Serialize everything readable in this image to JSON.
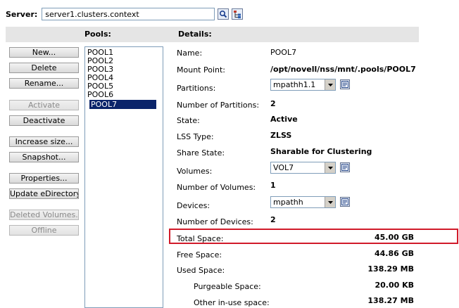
{
  "server": {
    "label": "Server:",
    "value": "server1.clusters.context"
  },
  "headers": {
    "pools": "Pools:",
    "details": "Details:"
  },
  "actions": [
    {
      "label": "New...",
      "enabled": true
    },
    {
      "label": "Delete",
      "enabled": true
    },
    {
      "label": "Rename...",
      "enabled": true
    },
    {
      "label": "Activate",
      "enabled": false
    },
    {
      "label": "Deactivate",
      "enabled": true
    },
    {
      "label": "Increase size...",
      "enabled": true
    },
    {
      "label": "Snapshot...",
      "enabled": true
    },
    {
      "label": "Properties...",
      "enabled": true
    },
    {
      "label": "Update eDirectory",
      "enabled": true
    },
    {
      "label": "Deleted Volumes...",
      "enabled": false
    },
    {
      "label": "Offline",
      "enabled": false
    }
  ],
  "pools": [
    "POOL1",
    "POOL2",
    "POOL3",
    "POOL4",
    "POOL5",
    "POOL6",
    "POOL7"
  ],
  "selected_pool": "POOL7",
  "details": {
    "name": {
      "label": "Name:",
      "value": "POOL7"
    },
    "mount_point": {
      "label": "Mount Point:",
      "value": "/opt/novell/nss/mnt/.pools/POOL7"
    },
    "partitions": {
      "label": "Partitions:",
      "value": "mpathh1.1"
    },
    "num_partitions": {
      "label": "Number of Partitions:",
      "value": "2"
    },
    "state": {
      "label": "State:",
      "value": "Active"
    },
    "lss_type": {
      "label": "LSS Type:",
      "value": "ZLSS"
    },
    "share_state": {
      "label": "Share State:",
      "value": "Sharable for Clustering"
    },
    "volumes": {
      "label": "Volumes:",
      "value": "VOL7"
    },
    "num_volumes": {
      "label": "Number of Volumes:",
      "value": "1"
    },
    "devices": {
      "label": "Devices:",
      "value": "mpathh"
    },
    "num_devices": {
      "label": "Number of Devices:",
      "value": "2"
    },
    "total_space": {
      "label": "Total Space:",
      "value": "45.00 GB"
    },
    "free_space": {
      "label": "Free Space:",
      "value": "44.86 GB"
    },
    "used_space": {
      "label": "Used Space:",
      "value": "138.29 MB"
    },
    "purgeable_space": {
      "label": "Purgeable Space:",
      "value": "20.00 KB"
    },
    "other_inuse_space": {
      "label": "Other in-use space:",
      "value": "138.27 MB"
    }
  },
  "colors": {
    "selection": "#0a246a",
    "highlight": "#d11a2a",
    "header_bg": "#e5e5e5"
  }
}
